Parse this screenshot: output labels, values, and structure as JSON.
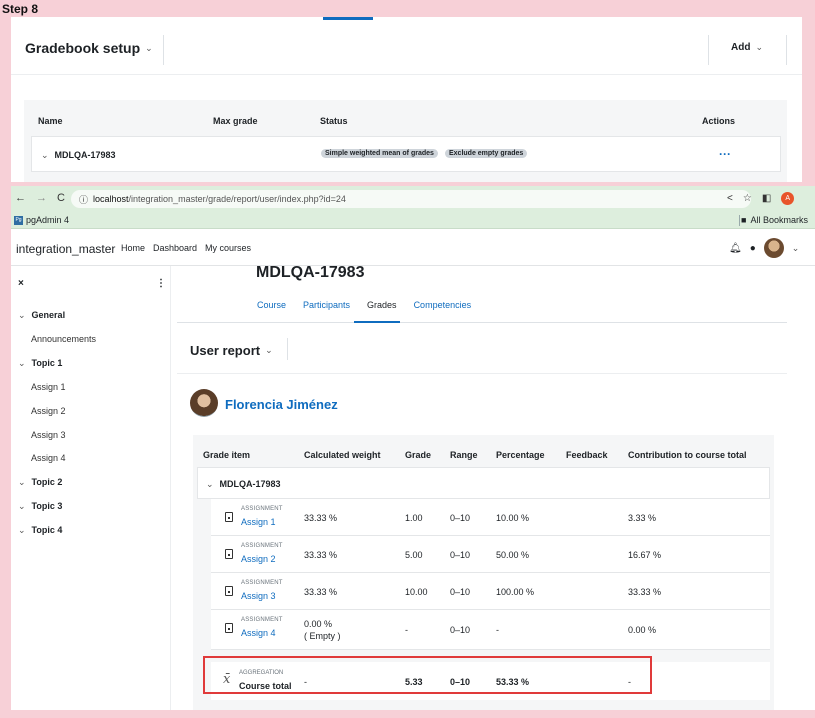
{
  "step_label": "Step 8",
  "setup": {
    "title": "Gradebook setup",
    "add_label": "Add",
    "columns": [
      "Name",
      "Max grade",
      "Status",
      "Actions"
    ],
    "category": "MDLQA-17983",
    "badges": [
      "Simple weighted mean of grades",
      "Exclude empty grades"
    ],
    "actions_label": "···"
  },
  "browser": {
    "url_host": "localhost",
    "url_path": "/integration_master/grade/report/user/index.php?id=24",
    "bookmark_pgadmin": "pgAdmin 4",
    "pg_icon_text": "Pg",
    "bookmark_all": "All Bookmarks",
    "profile_initial": "A"
  },
  "moodle": {
    "site_name": "integration_master",
    "nav": [
      "Home",
      "Dashboard",
      "My courses"
    ]
  },
  "drawer": {
    "close": "×",
    "menu": "⋮",
    "sections": [
      {
        "label": "General",
        "items": [
          "Announcements"
        ]
      },
      {
        "label": "Topic 1",
        "items": [
          "Assign 1",
          "Assign 2",
          "Assign 3",
          "Assign 4"
        ]
      },
      {
        "label": "Topic 2",
        "items": []
      },
      {
        "label": "Topic 3",
        "items": []
      },
      {
        "label": "Topic 4",
        "items": []
      }
    ]
  },
  "course": {
    "heading": "MDLQA-17983",
    "tabs": [
      "Course",
      "Participants",
      "Grades",
      "Competencies"
    ],
    "active_tab": "Grades"
  },
  "report": {
    "title": "User report",
    "user_name": "Florencia Jiménez",
    "columns": [
      "Grade item",
      "Calculated weight",
      "Grade",
      "Range",
      "Percentage",
      "Feedback",
      "Contribution to course total"
    ],
    "category": "MDLQA-17983",
    "items": [
      {
        "type": "ASSIGNMENT",
        "name": "Assign 1",
        "weight": "33.33 %",
        "weight_note": "",
        "grade": "1.00",
        "range": "0–10",
        "percentage": "10.00 %",
        "feedback": "",
        "contribution": "3.33 %"
      },
      {
        "type": "ASSIGNMENT",
        "name": "Assign 2",
        "weight": "33.33 %",
        "weight_note": "",
        "grade": "5.00",
        "range": "0–10",
        "percentage": "50.00 %",
        "feedback": "",
        "contribution": "16.67 %"
      },
      {
        "type": "ASSIGNMENT",
        "name": "Assign 3",
        "weight": "33.33 %",
        "weight_note": "",
        "grade": "10.00",
        "range": "0–10",
        "percentage": "100.00 %",
        "feedback": "",
        "contribution": "33.33 %"
      },
      {
        "type": "ASSIGNMENT",
        "name": "Assign 4",
        "weight": "0.00 %",
        "weight_note": "( Empty )",
        "grade": "-",
        "range": "0–10",
        "percentage": "-",
        "feedback": "",
        "contribution": "0.00 %"
      }
    ],
    "total": {
      "icon": "x̄",
      "type": "AGGREGATION",
      "label": "Course total",
      "weight": "-",
      "grade": "5.33",
      "range": "0–10",
      "percentage": "53.33 %",
      "contribution": "-"
    }
  }
}
